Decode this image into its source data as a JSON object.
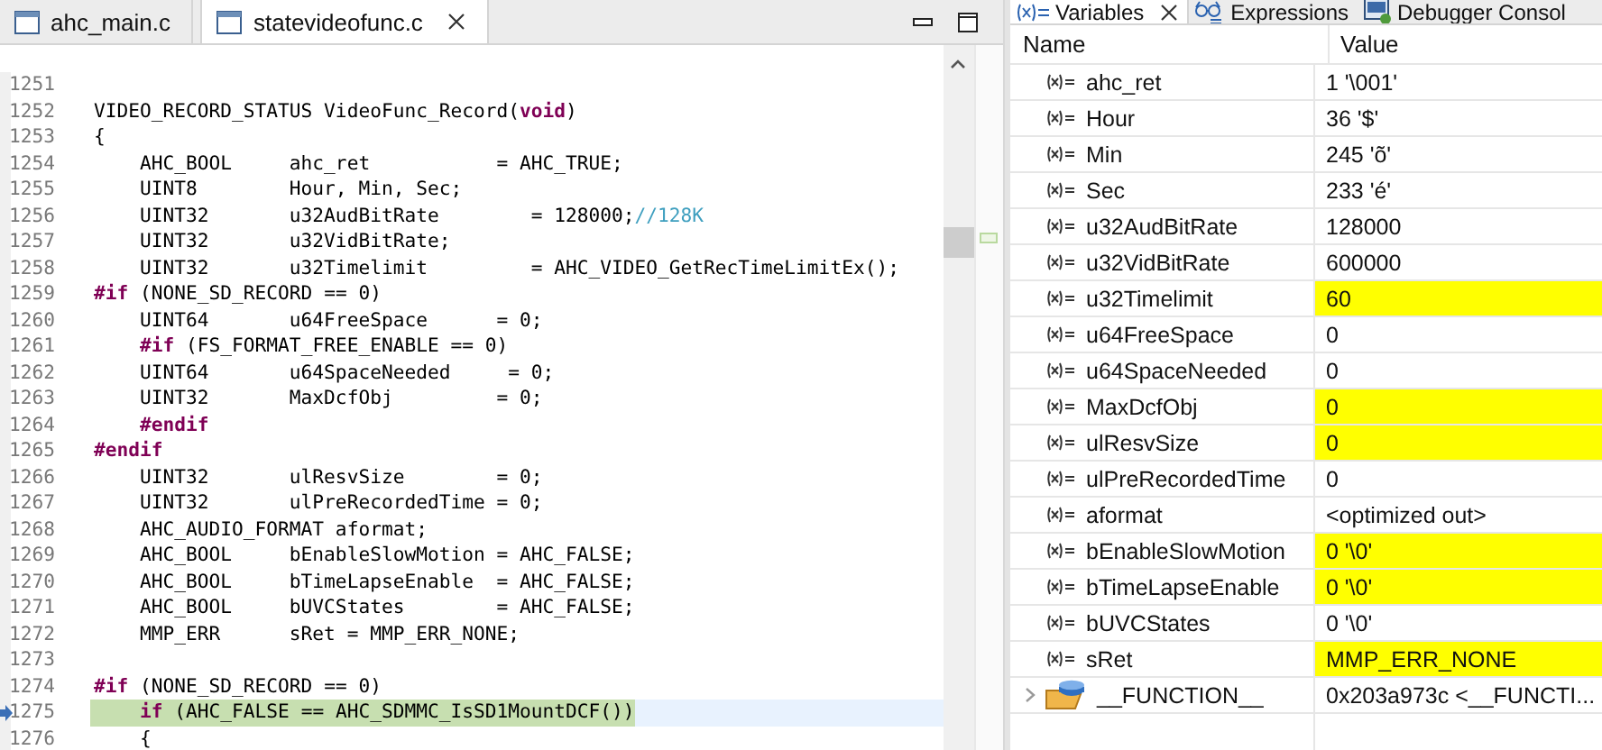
{
  "editor": {
    "tabs": [
      {
        "label": "ahc_main.c",
        "selected": false
      },
      {
        "label": "statevideofunc.c",
        "selected": true
      }
    ],
    "lines": [
      {
        "number": "1251",
        "current": false
      },
      {
        "number": "1252",
        "current": false,
        "segments": [
          {
            "kind": "plain",
            "text": "VIDEO_RECORD_STATUS VideoFunc_Record("
          },
          {
            "kind": "keyword",
            "text": "void"
          },
          {
            "kind": "plain",
            "text": ")"
          }
        ]
      },
      {
        "number": "1253",
        "current": false,
        "segments": [
          {
            "kind": "plain",
            "text": "{"
          }
        ]
      },
      {
        "number": "1254",
        "current": false,
        "segments": [
          {
            "kind": "plain",
            "text": "    AHC_BOOL     ahc_ret           = AHC_TRUE;"
          }
        ]
      },
      {
        "number": "1255",
        "current": false,
        "segments": [
          {
            "kind": "plain",
            "text": "    UINT8        Hour, Min, Sec;"
          }
        ]
      },
      {
        "number": "1256",
        "current": false,
        "segments": [
          {
            "kind": "plain",
            "text": "    UINT32       u32AudBitRate        = 128000;"
          },
          {
            "kind": "comment",
            "text": "//128K"
          }
        ]
      },
      {
        "number": "1257",
        "current": false,
        "segments": [
          {
            "kind": "plain",
            "text": "    UINT32       u32VidBitRate;"
          }
        ]
      },
      {
        "number": "1258",
        "current": false,
        "segments": [
          {
            "kind": "plain",
            "text": "    UINT32       u32Timelimit         = AHC_VIDEO_GetRecTimeLimitEx();"
          }
        ]
      },
      {
        "number": "1259",
        "current": false,
        "segments": [
          {
            "kind": "keyword",
            "text": "#if"
          },
          {
            "kind": "plain",
            "text": " (NONE_SD_RECORD == 0)"
          }
        ]
      },
      {
        "number": "1260",
        "current": false,
        "segments": [
          {
            "kind": "plain",
            "text": "    UINT64       u64FreeSpace      = 0;"
          }
        ]
      },
      {
        "number": "1261",
        "current": false,
        "segments": [
          {
            "kind": "keyword",
            "text": "    #if"
          },
          {
            "kind": "plain",
            "text": " (FS_FORMAT_FREE_ENABLE == 0)"
          }
        ]
      },
      {
        "number": "1262",
        "current": false,
        "segments": [
          {
            "kind": "plain",
            "text": "    UINT64       u64SpaceNeeded     = 0;"
          }
        ]
      },
      {
        "number": "1263",
        "current": false,
        "segments": [
          {
            "kind": "plain",
            "text": "    UINT32       MaxDcfObj         = 0;"
          }
        ]
      },
      {
        "number": "1264",
        "current": false,
        "segments": [
          {
            "kind": "keyword",
            "text": "    #endif"
          }
        ]
      },
      {
        "number": "1265",
        "current": false,
        "segments": [
          {
            "kind": "keyword",
            "text": "#endif"
          }
        ]
      },
      {
        "number": "1266",
        "current": false,
        "segments": [
          {
            "kind": "plain",
            "text": "    UINT32       ulResvSize        = 0;"
          }
        ]
      },
      {
        "number": "1267",
        "current": false,
        "segments": [
          {
            "kind": "plain",
            "text": "    UINT32       ulPreRecordedTime = 0;"
          }
        ]
      },
      {
        "number": "1268",
        "current": false,
        "segments": [
          {
            "kind": "plain",
            "text": "    AHC_AUDIO_FORMAT aformat;"
          }
        ]
      },
      {
        "number": "1269",
        "current": false,
        "segments": [
          {
            "kind": "plain",
            "text": "    AHC_BOOL     bEnableSlowMotion = AHC_FALSE;"
          }
        ]
      },
      {
        "number": "1270",
        "current": false,
        "segments": [
          {
            "kind": "plain",
            "text": "    AHC_BOOL     bTimeLapseEnable  = AHC_FALSE;"
          }
        ]
      },
      {
        "number": "1271",
        "current": false,
        "segments": [
          {
            "kind": "plain",
            "text": "    AHC_BOOL     bUVCStates        = AHC_FALSE;"
          }
        ]
      },
      {
        "number": "1272",
        "current": false,
        "segments": [
          {
            "kind": "plain",
            "text": "    MMP_ERR      sRet = MMP_ERR_NONE;"
          }
        ]
      },
      {
        "number": "1273",
        "current": false
      },
      {
        "number": "1274",
        "current": false,
        "segments": [
          {
            "kind": "keyword",
            "text": "#if"
          },
          {
            "kind": "plain",
            "text": " (NONE_SD_RECORD == 0)"
          }
        ]
      },
      {
        "number": "1275",
        "current": true,
        "segments": [
          {
            "kind": "keyword",
            "text": "    if"
          },
          {
            "kind": "plain",
            "text": " (AHC_FALSE == AHC_SDMMC_IsSD1MountDCF())"
          }
        ]
      },
      {
        "number": "1276",
        "current": false,
        "segments": [
          {
            "kind": "plain",
            "text": "    {"
          }
        ]
      }
    ]
  },
  "variables_view": {
    "tabs": [
      {
        "label": "Variables",
        "kind": "variables",
        "selected": true
      },
      {
        "label": "Expressions",
        "kind": "expressions",
        "selected": false
      },
      {
        "label": "Debugger Consol",
        "kind": "console",
        "selected": false
      }
    ],
    "columns": [
      "Name",
      "Value"
    ],
    "rows": [
      {
        "kind": "variable",
        "name": "ahc_ret",
        "value": "1 '\\001'",
        "changed": false
      },
      {
        "kind": "variable",
        "name": "Hour",
        "value": "36 '$'",
        "changed": false
      },
      {
        "kind": "variable",
        "name": "Min",
        "value": "245 'õ'",
        "changed": false
      },
      {
        "kind": "variable",
        "name": "Sec",
        "value": "233 'é'",
        "changed": false
      },
      {
        "kind": "variable",
        "name": "u32AudBitRate",
        "value": "128000",
        "changed": false
      },
      {
        "kind": "variable",
        "name": "u32VidBitRate",
        "value": "600000",
        "changed": false
      },
      {
        "kind": "variable",
        "name": "u32Timelimit",
        "value": "60",
        "changed": true
      },
      {
        "kind": "variable",
        "name": "u64FreeSpace",
        "value": "0",
        "changed": false
      },
      {
        "kind": "variable",
        "name": "u64SpaceNeeded",
        "value": "0",
        "changed": false
      },
      {
        "kind": "variable",
        "name": "MaxDcfObj",
        "value": "0",
        "changed": true
      },
      {
        "kind": "variable",
        "name": "ulResvSize",
        "value": "0",
        "changed": true
      },
      {
        "kind": "variable",
        "name": "ulPreRecordedTime",
        "value": "0",
        "changed": false
      },
      {
        "kind": "variable",
        "name": "aformat",
        "value": "<optimized out>",
        "changed": false
      },
      {
        "kind": "variable",
        "name": "bEnableSlowMotion",
        "value": "0 '\\0'",
        "changed": true
      },
      {
        "kind": "variable",
        "name": "bTimeLapseEnable",
        "value": "0 '\\0'",
        "changed": true
      },
      {
        "kind": "variable",
        "name": "bUVCStates",
        "value": "0 '\\0'",
        "changed": false
      },
      {
        "kind": "variable",
        "name": "sRet",
        "value": "MMP_ERR_NONE",
        "changed": true
      },
      {
        "kind": "struct",
        "name": "__FUNCTION__",
        "value": "0x203a973c <__FUNCTI...",
        "changed": false,
        "expanded": false
      }
    ]
  }
}
